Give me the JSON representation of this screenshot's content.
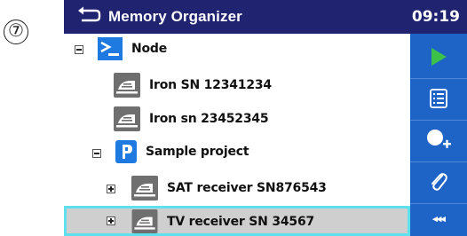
{
  "step_marker": "⑦",
  "header": {
    "title": "Memory Organizer",
    "time": "09:19"
  },
  "tree": {
    "node": {
      "label": "Node"
    },
    "iron1": {
      "label": "Iron SN 12341234"
    },
    "iron2": {
      "label": "Iron sn 23452345"
    },
    "project": {
      "label": "Sample project"
    },
    "sat": {
      "label": "SAT receiver SN876543"
    },
    "tv": {
      "label": "TV receiver SN 34567",
      "selected": true
    }
  },
  "sidebar": {
    "more_label": "◂◂◂"
  },
  "colors": {
    "title_bar": "#1f2370",
    "sidebar": "#1e63c6",
    "play": "#3cc24a",
    "selection_border": "#5ee0ee",
    "selection_fill": "#cfcfcf"
  }
}
